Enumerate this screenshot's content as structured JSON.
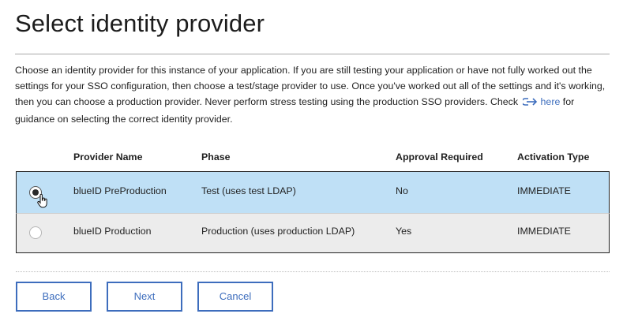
{
  "page": {
    "title": "Select identity provider",
    "description_before_link": "Choose an identity provider for this instance of your application. If you are still testing your application or have not fully worked out the settings for your SSO configuration, then choose a test/stage provider to use. Once you've worked out all of the settings and it's working, then you can choose a production provider. Never perform stress testing using the production SSO providers. Check",
    "link_label": "here",
    "description_after_link": "for guidance on selecting the correct identity provider.",
    "link_icon": "arrow-right-icon"
  },
  "table": {
    "headers": {
      "name": "Provider Name",
      "phase": "Phase",
      "approval": "Approval Required",
      "activation": "Activation Type"
    },
    "rows": [
      {
        "name": "blueID PreProduction",
        "phase": "Test (uses test LDAP)",
        "approval": "No",
        "activation": "IMMEDIATE",
        "selected": true
      },
      {
        "name": "blueID Production",
        "phase": "Production (uses production LDAP)",
        "approval": "Yes",
        "activation": "IMMEDIATE",
        "selected": false
      }
    ]
  },
  "buttons": {
    "back": "Back",
    "next": "Next",
    "cancel": "Cancel"
  },
  "colors": {
    "accent": "#3d6dbd",
    "selected_row": "#bfe0f6",
    "unselected_row": "#ececec"
  }
}
